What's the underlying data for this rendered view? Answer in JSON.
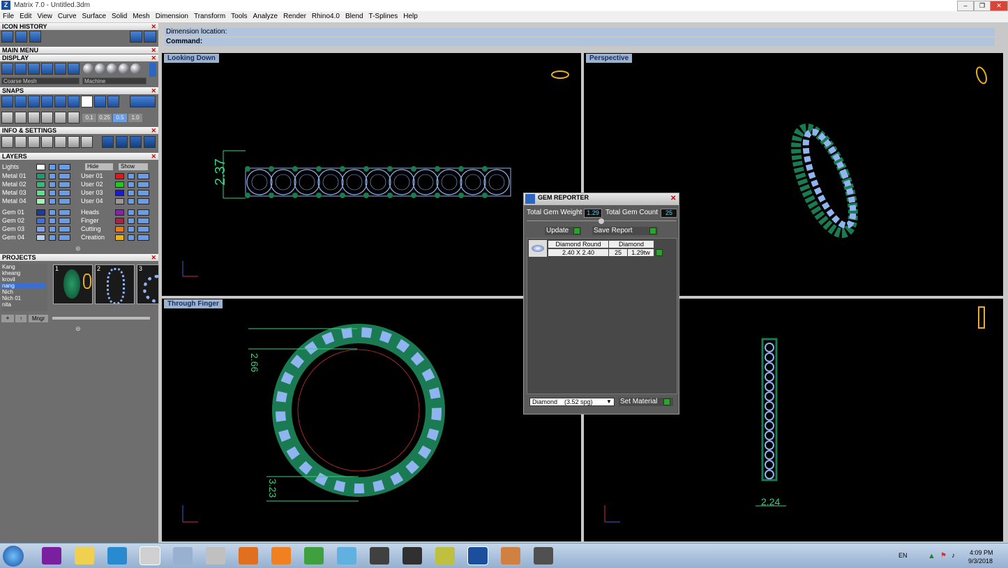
{
  "window": {
    "title": "Matrix 7.0 - Untitled.3dm"
  },
  "menu": [
    "File",
    "Edit",
    "View",
    "Curve",
    "Surface",
    "Solid",
    "Mesh",
    "Dimension",
    "Transform",
    "Tools",
    "Analyze",
    "Render",
    "Rhino4.0",
    "Blend",
    "T-Splines",
    "Help"
  ],
  "left": {
    "icon_history": "ICON HISTORY",
    "main_menu": "MAIN MENU",
    "display": "DISPLAY",
    "display_combo_mesh": "Coarse Mesh",
    "display_combo_render": "Machine",
    "snaps": "SNAPS",
    "snap_values": [
      "0.1",
      "0.25",
      "0.5",
      "1.0"
    ],
    "info_settings": "INFO & SETTINGS",
    "layers": "LAYERS",
    "lights": "Lights",
    "hide": "Hide",
    "show": "Show",
    "layers_left": [
      {
        "name": "Metal 01",
        "color": "#1f9a6b"
      },
      {
        "name": "Metal 02",
        "color": "#2fbf72"
      },
      {
        "name": "Metal 03",
        "color": "#5fe08a"
      },
      {
        "name": "Metal 04",
        "color": "#a6f2b4"
      },
      {
        "name": "Gem 01",
        "color": "#1a3aa8"
      },
      {
        "name": "Gem 02",
        "color": "#3f6fe0"
      },
      {
        "name": "Gem 03",
        "color": "#7fa4ef"
      },
      {
        "name": "Gem 04",
        "color": "#b5cdf7"
      }
    ],
    "layers_right": [
      {
        "name": "User 01",
        "color": "#e01818"
      },
      {
        "name": "User 02",
        "color": "#18d018"
      },
      {
        "name": "User 03",
        "color": "#1818e0"
      },
      {
        "name": "User 04",
        "color": "#9a9a9a"
      },
      {
        "name": "Heads",
        "color": "#8a1fb0"
      },
      {
        "name": "Finger",
        "color": "#b02040"
      },
      {
        "name": "Cutting",
        "color": "#f07a10"
      },
      {
        "name": "Creation",
        "color": "#f0b010"
      }
    ],
    "projects": "PROJECTS",
    "project_names": [
      "Kang",
      "kheang",
      "krovil",
      "nang",
      "Nich",
      "Nich 01",
      "nita"
    ],
    "selected_project": "nang",
    "thumb_numbers": [
      "1",
      "2",
      "3"
    ],
    "mngr": "Mngr"
  },
  "command": {
    "prompt": "Dimension location:",
    "label": "Command:"
  },
  "viewports": {
    "top_left": "Looking Down",
    "top_right": "Perspective",
    "bottom_left": "Through Finger",
    "bottom_right": ""
  },
  "dimensions": {
    "height": "2.37",
    "upper": "2.66",
    "lower": "3.23",
    "width": "2.24"
  },
  "gem_reporter": {
    "title": "GEM REPORTER",
    "total_weight_label": "Total Gem Weight",
    "total_weight": "1.29",
    "total_count_label": "Total Gem Count",
    "total_count": "25",
    "update": "Update",
    "save_report": "Save Report",
    "col_shape": "Diamond Round",
    "col_material": "Diamond",
    "size": "2.40 X 2.40",
    "count": "25",
    "weight": "1.29tw",
    "material_select": "Diamond    (3.52 spg)",
    "set_material": "Set Material"
  },
  "taskbar": {
    "lang": "EN",
    "time": "4:09 PM",
    "date": "9/3/2018"
  },
  "colors": {
    "metal": "#1a7a52",
    "gem": "#8fb4f0",
    "viewport_bg": "#000000",
    "gold_icon": "#e8b020"
  }
}
